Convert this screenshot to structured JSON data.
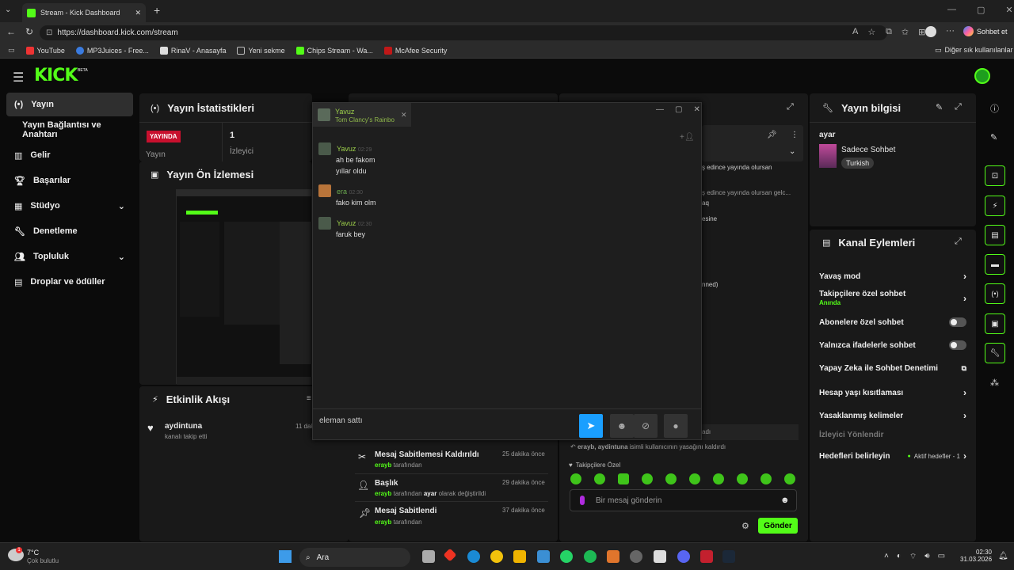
{
  "browser": {
    "tab_title": "Stream - Kick Dashboard",
    "url": "https://dashboard.kick.com/stream",
    "profile_button": "Sohbet et",
    "bookmarks": [
      "YouTube",
      "MP3Juices - Free...",
      "RinaV - Anasayfa",
      "Yeni sekme",
      "Chips Stream - Wa...",
      "McAfee Security"
    ],
    "other_bookmarks": "Diğer sık kullanılanlar"
  },
  "brand": {
    "logo": "KICK",
    "beta": "BETA",
    "accent": "#53fc18"
  },
  "sidebar": {
    "items": [
      {
        "label": "Yayın"
      },
      {
        "label": "Yayın Bağlantısı ve Anahtarı"
      },
      {
        "label": "Gelir"
      },
      {
        "label": "Başarılar"
      },
      {
        "label": "Stüdyo"
      },
      {
        "label": "Denetleme"
      },
      {
        "label": "Topluluk"
      },
      {
        "label": "Droplar ve ödüller"
      }
    ]
  },
  "stats": {
    "title": "Yayın İstatistikleri",
    "live_badge": "YAYINDA",
    "live_label": "Yayın",
    "viewers_value": "1",
    "viewers_label": "İzleyici"
  },
  "preview": {
    "title": "Yayın Ön İzlemesi"
  },
  "activity": {
    "title": "Etkinlik Akışı",
    "item_user": "aydintuna",
    "item_text": "kanalı takip etti",
    "item_time": "11 dak"
  },
  "log": [
    {
      "title": "Mesaj Sabitlemesi Kaldırıldı",
      "time": "25 dakika önce",
      "user": "erayb",
      "rest": "tarafından"
    },
    {
      "title": "Başlık",
      "time": "29 dakika önce",
      "user": "erayb",
      "rest": "tarafından",
      "bold": "ayar",
      "rest2": "olarak değiştirildi"
    },
    {
      "title": "Mesaj Sabitlendi",
      "time": "37 dakika önce",
      "user": "erayb",
      "rest": "tarafından"
    }
  ],
  "chatpanel": {
    "frag1": "ş edince yayında olursan",
    "frag2": "ş edince yayında olursan gelc...",
    "frag3": "aq",
    "frag4": "esine",
    "frag5": "nned)",
    "frag6": "adı",
    "unban_user": "erayb, aydintuna",
    "unban_text": "isimli kullanıcının yasağını kaldırdı",
    "followers_only": "Takipçilere Özel",
    "input_placeholder": "Bir mesaj gönderin",
    "send": "Gönder"
  },
  "streaminfo": {
    "title": "Yayın bilgisi",
    "stream_title": "ayar",
    "category": "Sadece Sohbet",
    "language": "Turkish"
  },
  "actions": {
    "title": "Kanal Eylemleri",
    "items": [
      {
        "label": "Yavaş mod"
      },
      {
        "label": "Takipçilere özel sohbet",
        "sub": "Anında"
      },
      {
        "label": "Abonelere özel sohbet"
      },
      {
        "label": "Yalnızca ifadelerle sohbet"
      },
      {
        "label": "Yapay Zeka ile Sohbet Denetimi"
      },
      {
        "label": "Hesap yaşı kısıtlaması"
      },
      {
        "label": "Yasaklanmış kelimeler"
      },
      {
        "label": "İzleyici Yönlendir"
      },
      {
        "label": "Hedefleri belirleyin",
        "status": "Aktif hedefler - 1"
      }
    ]
  },
  "chatwindow": {
    "name": "Yavuz",
    "game": "Tom Clancy's Rainbo",
    "messages": [
      {
        "user": "Yavuz",
        "time": "02:29",
        "lines": [
          "ah be fakom",
          "yıllar oldu"
        ]
      },
      {
        "user": "era",
        "time": "02:30",
        "lines": [
          "fako kim olm"
        ]
      },
      {
        "user": "Yavuz",
        "time": "02:30",
        "lines": [
          "faruk bey"
        ]
      }
    ],
    "input_value": "eleman sattı "
  },
  "taskbar": {
    "temp": "7°C",
    "weather": "Çok bulutlu",
    "search": "Ara",
    "time": "02:30",
    "date": "31.03.2026",
    "badge": "1"
  }
}
